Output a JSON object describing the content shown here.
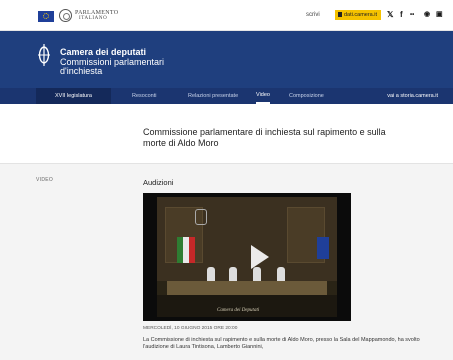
{
  "topbar": {
    "parliament_line1": "PARLAMENTO",
    "parliament_line2": "ITALIANO",
    "scrivi_label": "scrivi",
    "dati_label": "dati.camera.it",
    "social": [
      "𝕏",
      "f",
      "••",
      "◉",
      "▣"
    ]
  },
  "header": {
    "title": "Camera dei deputati",
    "subtitle_line1": "Commissioni parlamentari",
    "subtitle_line2": "d'inchiesta"
  },
  "nav": {
    "legislature": "XVII legislatura",
    "items": [
      "Resoconti",
      "Relazioni presentate",
      "Video",
      "Composizione"
    ],
    "active_index": 2,
    "right_link": "vai a storia.camera.it"
  },
  "page": {
    "commission_title": "Commissione parlamentare di inchiesta sul rapimento e sulla morte di Aldo Moro"
  },
  "section": {
    "label": "VIDEO",
    "title": "Audizioni"
  },
  "video": {
    "caption_overlay": "Camera dei Deputati",
    "meta": "MERCOLEDÌ, 10 GIUGNO 2015 ORE 20:00",
    "description": "La Commissione di inchiesta sul rapimento e sulla morte di Aldo Moro, presso la Sala del Mappamondo, ha svolto l'audizione di Laura Tintisona, Lamberto Giannini,"
  },
  "colors": {
    "header_blue": "#1f3f7e",
    "nav_blue": "#1b3570",
    "accent_yellow": "#f5c200"
  }
}
